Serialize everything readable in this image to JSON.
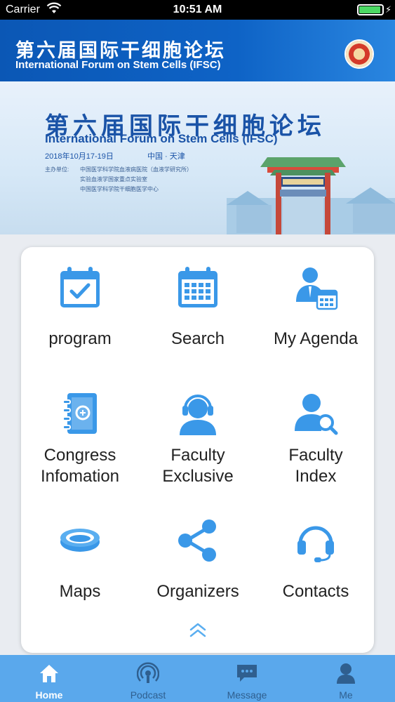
{
  "status_bar": {
    "carrier": "Carrier",
    "time": "10:51 AM"
  },
  "header": {
    "title_cn": "第六届国际干细胞论坛",
    "title_en": "International Forum on Stem Cells (IFSC)",
    "emblem_icon": "institute-emblem-icon"
  },
  "banner": {
    "title_cn": "第六届国际干细胞论坛",
    "title_en": "International Forum on Stem Cells (IFSC)",
    "date": "2018年10月17-19日",
    "place": "中国 · 天津",
    "organizers_label": "主办单位:",
    "organizers": [
      "中国医学科学院血液病医院（血液学研究所）",
      "实验血液学国家重点实验室",
      "中国医学科学院干细胞医学中心"
    ]
  },
  "menu": {
    "items": [
      {
        "label": "program",
        "icon": "calendar-check-icon"
      },
      {
        "label": "Search",
        "icon": "calendar-grid-icon"
      },
      {
        "label": "My Agenda",
        "icon": "person-calendar-icon"
      },
      {
        "label": "Congress\nInfomation",
        "lines": [
          "Congress",
          "Infomation"
        ],
        "icon": "notebook-icon"
      },
      {
        "label": "Faculty\nExclusive",
        "lines": [
          "Faculty",
          "Exclusive"
        ],
        "icon": "headset-person-icon"
      },
      {
        "label": "Faculty\nIndex",
        "lines": [
          "Faculty",
          "Index"
        ],
        "icon": "person-search-icon"
      },
      {
        "label": "Maps",
        "icon": "stadium-icon"
      },
      {
        "label": "Organizers",
        "icon": "share-icon"
      },
      {
        "label": "Contacts",
        "icon": "headphones-icon"
      }
    ],
    "collapse_icon": "chevron-up-icon"
  },
  "tabbar": {
    "tabs": [
      {
        "label": "Home",
        "icon": "home-icon",
        "active": true
      },
      {
        "label": "Podcast",
        "icon": "podcast-icon",
        "active": false
      },
      {
        "label": "Message",
        "icon": "message-icon",
        "active": false
      },
      {
        "label": "Me",
        "icon": "user-icon",
        "active": false
      }
    ]
  },
  "colors": {
    "accent": "#3a98e8",
    "header": "#0e63c6",
    "tabbar": "#5aa8ec"
  }
}
